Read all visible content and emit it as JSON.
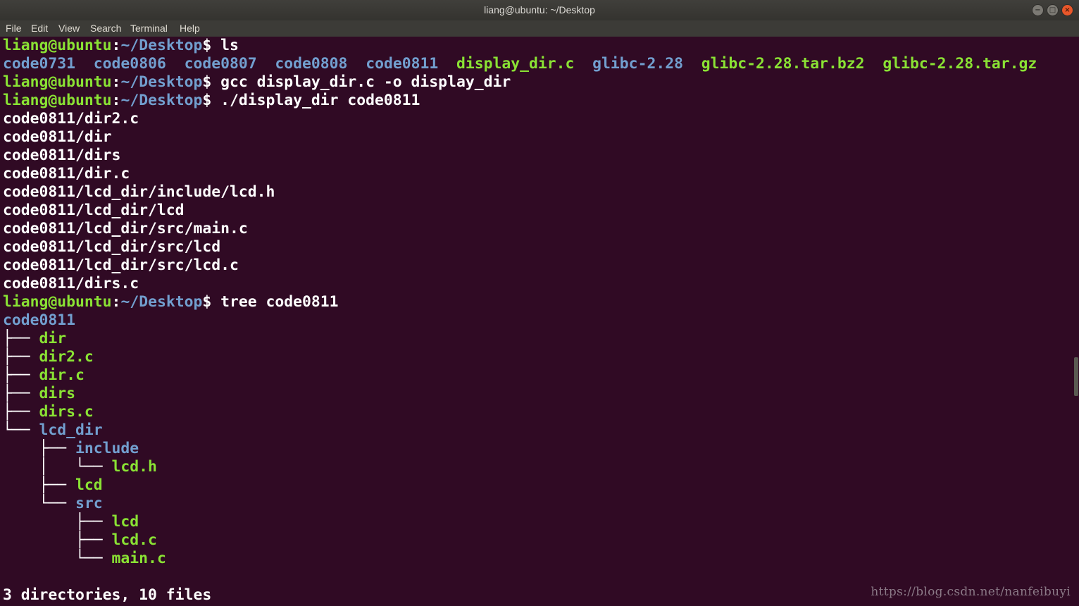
{
  "window": {
    "title": "liang@ubuntu: ~/Desktop",
    "buttons": {
      "minimize": "−",
      "maximize": "□",
      "close": "×"
    }
  },
  "menu": [
    "File",
    "Edit",
    "View",
    "Search",
    "Terminal",
    "Help"
  ],
  "prompt": {
    "user_host": "liang@ubuntu",
    "colon": ":",
    "path": "~/Desktop",
    "dollar": "$ "
  },
  "lines": [
    {
      "type": "prompt",
      "cmd": "ls"
    },
    {
      "type": "ls",
      "items": [
        {
          "text": "code0731",
          "c": "b"
        },
        {
          "text": "  ",
          "c": "w"
        },
        {
          "text": "code0806",
          "c": "b"
        },
        {
          "text": "  ",
          "c": "w"
        },
        {
          "text": "code0807",
          "c": "b"
        },
        {
          "text": "  ",
          "c": "w"
        },
        {
          "text": "code0808",
          "c": "b"
        },
        {
          "text": "  ",
          "c": "w"
        },
        {
          "text": "code0811",
          "c": "b"
        },
        {
          "text": "  ",
          "c": "w"
        },
        {
          "text": "display_dir.c",
          "c": "g"
        },
        {
          "text": "  ",
          "c": "w"
        },
        {
          "text": "glibc-2.28",
          "c": "b"
        },
        {
          "text": "  ",
          "c": "w"
        },
        {
          "text": "glibc-2.28.tar.bz2",
          "c": "g"
        },
        {
          "text": "  ",
          "c": "w"
        },
        {
          "text": "glibc-2.28.tar.gz",
          "c": "g"
        }
      ]
    },
    {
      "type": "prompt",
      "cmd": "gcc display_dir.c -o display_dir"
    },
    {
      "type": "prompt",
      "cmd": "./display_dir code0811"
    },
    {
      "type": "out",
      "text": "code0811/dir2.c"
    },
    {
      "type": "out",
      "text": "code0811/dir"
    },
    {
      "type": "out",
      "text": "code0811/dirs"
    },
    {
      "type": "out",
      "text": "code0811/dir.c"
    },
    {
      "type": "out",
      "text": "code0811/lcd_dir/include/lcd.h"
    },
    {
      "type": "out",
      "text": "code0811/lcd_dir/lcd"
    },
    {
      "type": "out",
      "text": "code0811/lcd_dir/src/main.c"
    },
    {
      "type": "out",
      "text": "code0811/lcd_dir/src/lcd"
    },
    {
      "type": "out",
      "text": "code0811/lcd_dir/src/lcd.c"
    },
    {
      "type": "out",
      "text": "code0811/dirs.c"
    },
    {
      "type": "prompt",
      "cmd": "tree code0811"
    },
    {
      "type": "tree",
      "prefix": "",
      "name": "code0811",
      "c": "b"
    },
    {
      "type": "tree",
      "prefix": "├── ",
      "name": "dir",
      "c": "g"
    },
    {
      "type": "tree",
      "prefix": "├── ",
      "name": "dir2.c",
      "c": "g"
    },
    {
      "type": "tree",
      "prefix": "├── ",
      "name": "dir.c",
      "c": "g"
    },
    {
      "type": "tree",
      "prefix": "├── ",
      "name": "dirs",
      "c": "g"
    },
    {
      "type": "tree",
      "prefix": "├── ",
      "name": "dirs.c",
      "c": "g"
    },
    {
      "type": "tree",
      "prefix": "└── ",
      "name": "lcd_dir",
      "c": "b"
    },
    {
      "type": "tree",
      "prefix": "    ├── ",
      "name": "include",
      "c": "b"
    },
    {
      "type": "tree",
      "prefix": "    │   └── ",
      "name": "lcd.h",
      "c": "g"
    },
    {
      "type": "tree",
      "prefix": "    ├── ",
      "name": "lcd",
      "c": "g"
    },
    {
      "type": "tree",
      "prefix": "    └── ",
      "name": "src",
      "c": "b"
    },
    {
      "type": "tree",
      "prefix": "        ├── ",
      "name": "lcd",
      "c": "g"
    },
    {
      "type": "tree",
      "prefix": "        ├── ",
      "name": "lcd.c",
      "c": "g"
    },
    {
      "type": "tree",
      "prefix": "        └── ",
      "name": "main.c",
      "c": "g"
    },
    {
      "type": "out",
      "text": ""
    },
    {
      "type": "out",
      "text": "3 directories, 10 files"
    }
  ],
  "watermark": "https://blog.csdn.net/nanfeibuyi",
  "colors": {
    "background": "#300a24",
    "prompt_green": "#8ae234",
    "dir_blue": "#729fcf",
    "text": "#ffffff"
  }
}
